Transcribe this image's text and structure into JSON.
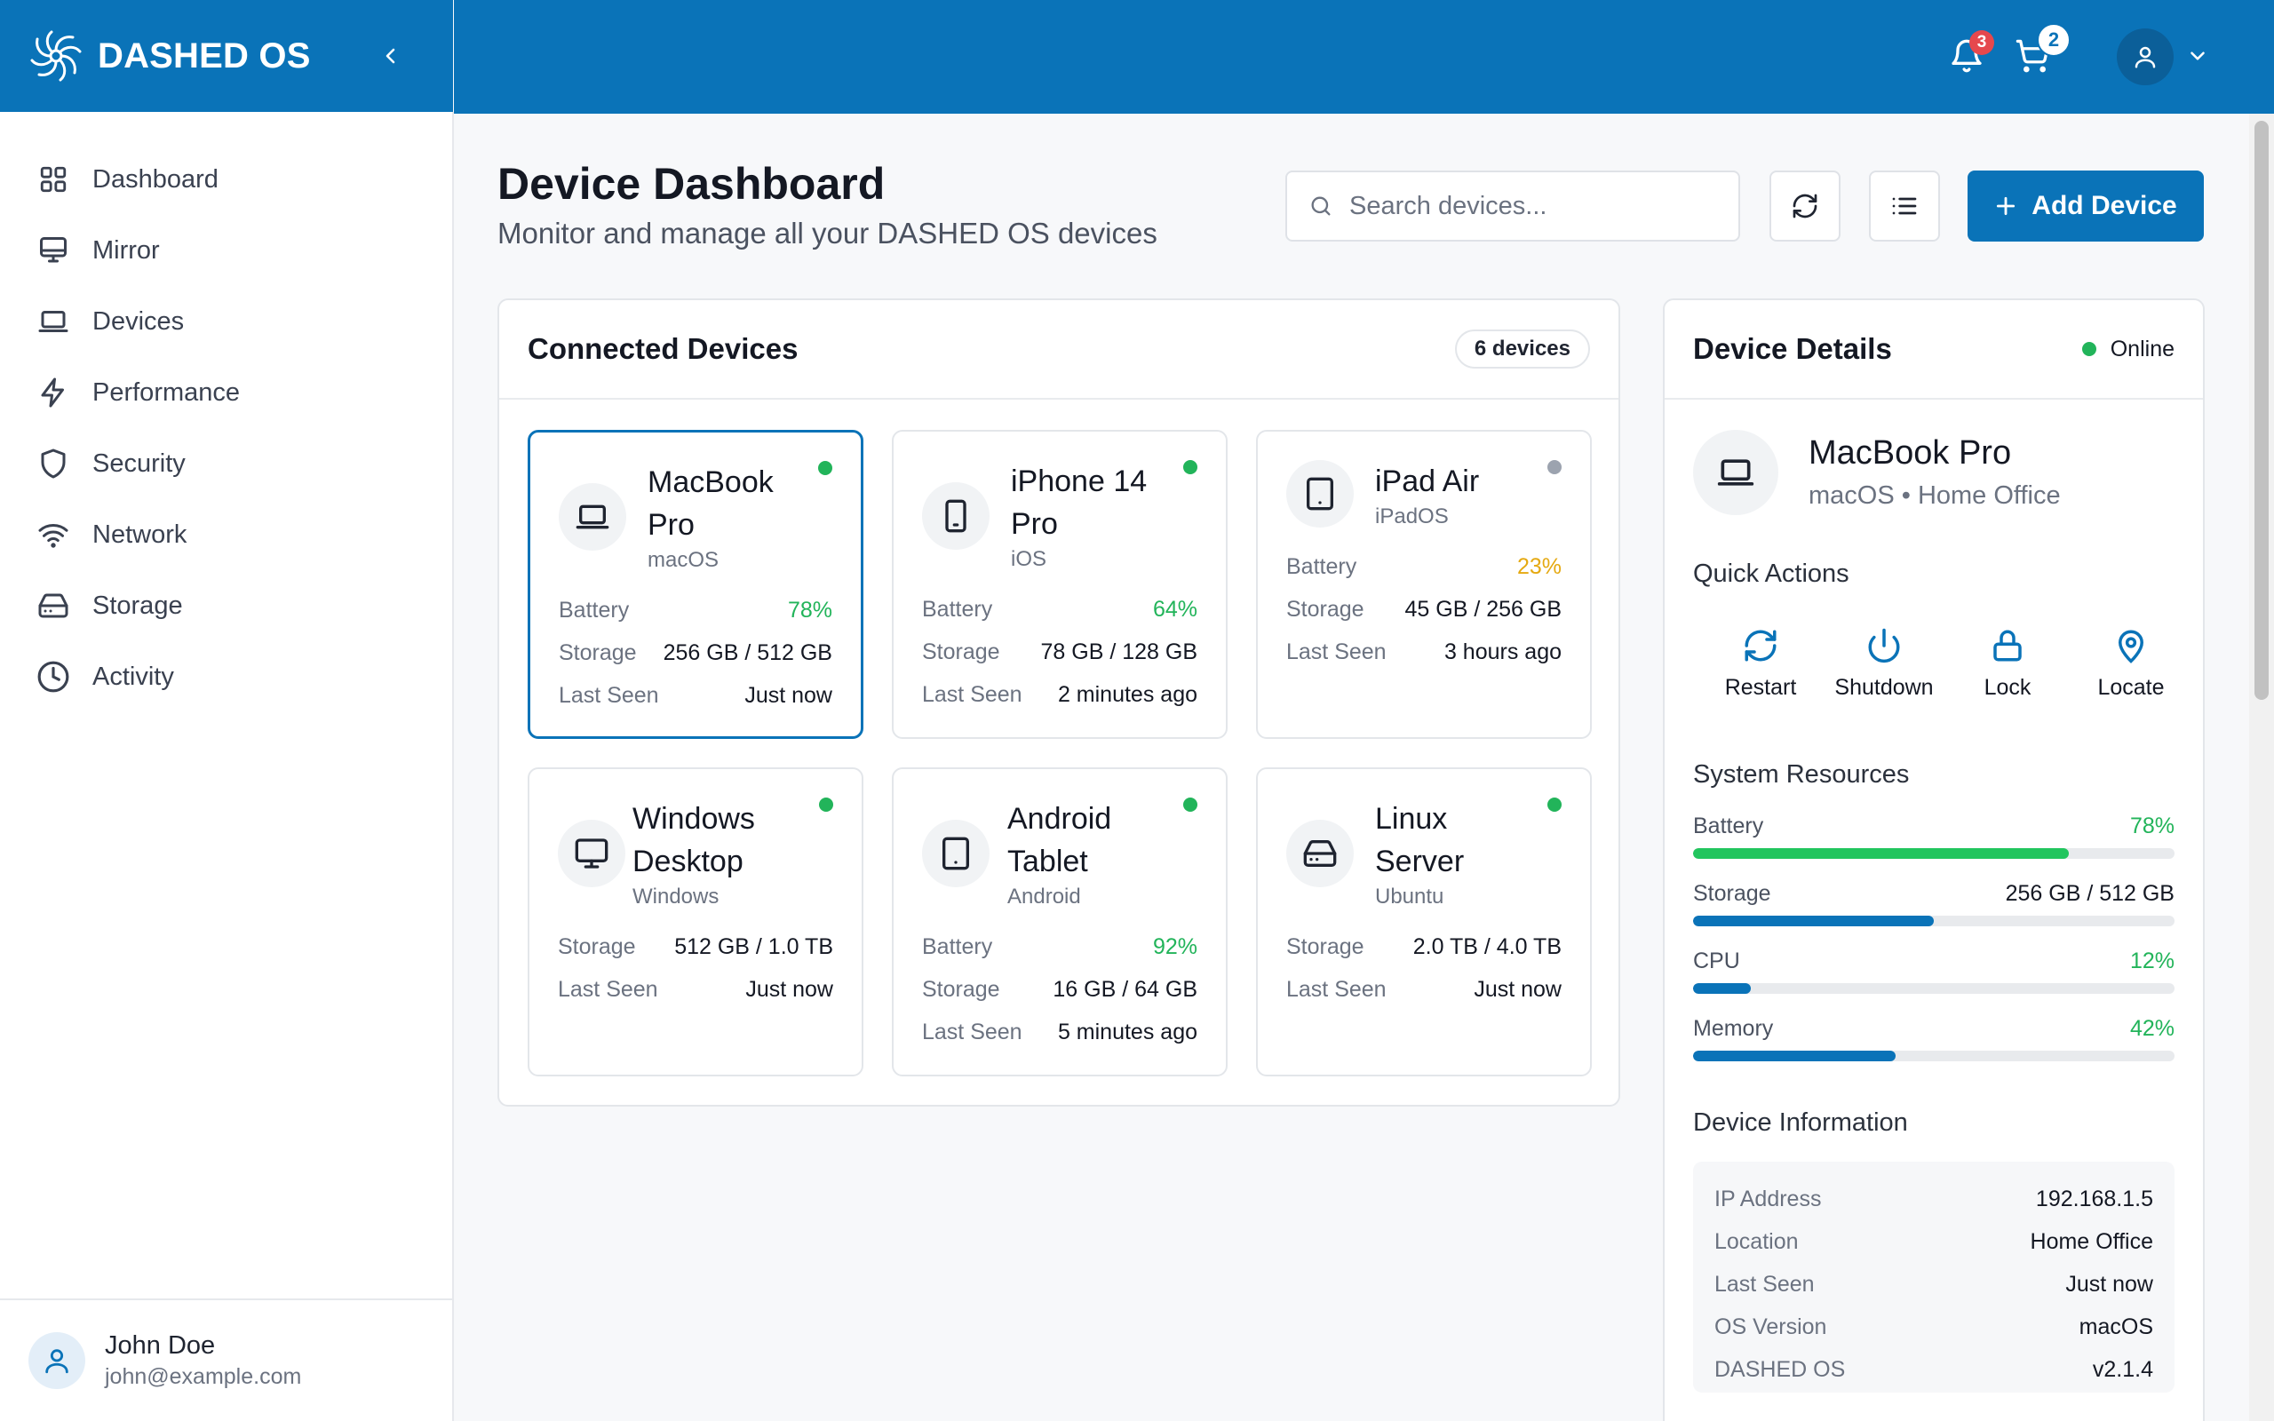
{
  "brand": {
    "name": "DASHED OS"
  },
  "topbar": {
    "notifications_count": "3",
    "cart_count": "2"
  },
  "sidebar": {
    "items": [
      {
        "label": "Dashboard",
        "icon": "grid-icon"
      },
      {
        "label": "Mirror",
        "icon": "monitor-icon"
      },
      {
        "label": "Devices",
        "icon": "laptop-icon"
      },
      {
        "label": "Performance",
        "icon": "bolt-icon"
      },
      {
        "label": "Security",
        "icon": "shield-icon"
      },
      {
        "label": "Network",
        "icon": "wifi-icon"
      },
      {
        "label": "Storage",
        "icon": "hard-drive-icon"
      },
      {
        "label": "Activity",
        "icon": "clock-icon"
      }
    ],
    "user": {
      "name": "John Doe",
      "email": "john@example.com"
    }
  },
  "header": {
    "title": "Device Dashboard",
    "subtitle": "Monitor and manage all your DASHED OS devices",
    "search_placeholder": "Search devices...",
    "add_label": "Add Device"
  },
  "devices_panel": {
    "title": "Connected Devices",
    "count_label": "6 devices",
    "devices": [
      {
        "name1": "MacBook",
        "name2": "Pro",
        "os": "macOS",
        "status": "online",
        "rows": [
          {
            "k": "Battery",
            "v": "78%",
            "tone": "green"
          },
          {
            "k": "Storage",
            "v": "256 GB / 512 GB"
          },
          {
            "k": "Last Seen",
            "v": "Just now"
          }
        ]
      },
      {
        "name1": "iPhone 14",
        "name2": "Pro",
        "os": "iOS",
        "status": "online",
        "rows": [
          {
            "k": "Battery",
            "v": "64%",
            "tone": "green"
          },
          {
            "k": "Storage",
            "v": "78 GB / 128 GB"
          },
          {
            "k": "Last Seen",
            "v": "2 minutes ago"
          }
        ]
      },
      {
        "name1": "iPad Air",
        "name2": "",
        "os": "iPadOS",
        "status": "offline",
        "rows": [
          {
            "k": "Battery",
            "v": "23%",
            "tone": "yellow"
          },
          {
            "k": "Storage",
            "v": "45 GB / 256 GB"
          },
          {
            "k": "Last Seen",
            "v": "3 hours ago"
          }
        ]
      },
      {
        "name1": "Windows",
        "name2": "Desktop",
        "os": "Windows",
        "status": "online",
        "rows": [
          {
            "k": "Storage",
            "v": "512 GB / 1.0 TB"
          },
          {
            "k": "Last Seen",
            "v": "Just now"
          }
        ]
      },
      {
        "name1": "Android",
        "name2": "Tablet",
        "os": "Android",
        "status": "online",
        "rows": [
          {
            "k": "Battery",
            "v": "92%",
            "tone": "green"
          },
          {
            "k": "Storage",
            "v": "16 GB / 64 GB"
          },
          {
            "k": "Last Seen",
            "v": "5 minutes ago"
          }
        ]
      },
      {
        "name1": "Linux",
        "name2": "Server",
        "os": "Ubuntu",
        "status": "online",
        "rows": [
          {
            "k": "Storage",
            "v": "2.0 TB / 4.0 TB"
          },
          {
            "k": "Last Seen",
            "v": "Just now"
          }
        ]
      }
    ]
  },
  "details": {
    "title": "Device Details",
    "status": "Online",
    "device_name": "MacBook Pro",
    "device_sub": "macOS • Home Office",
    "quick_actions_label": "Quick Actions",
    "quick_actions": [
      {
        "label": "Restart"
      },
      {
        "label": "Shutdown"
      },
      {
        "label": "Lock"
      },
      {
        "label": "Locate"
      }
    ],
    "resources_label": "System Resources",
    "resources": [
      {
        "k": "Battery",
        "v": "78%",
        "pct": 78,
        "color": "#22c55e",
        "tone": "green"
      },
      {
        "k": "Storage",
        "v": "256 GB / 512 GB",
        "pct": 50,
        "color": "#0a73b8",
        "tone": ""
      },
      {
        "k": "CPU",
        "v": "12%",
        "pct": 12,
        "color": "#0a73b8",
        "tone": "green"
      },
      {
        "k": "Memory",
        "v": "42%",
        "pct": 42,
        "color": "#0a73b8",
        "tone": "green"
      }
    ],
    "info_label": "Device Information",
    "info": [
      {
        "k": "IP Address",
        "v": "192.168.1.5"
      },
      {
        "k": "Location",
        "v": "Home Office"
      },
      {
        "k": "Last Seen",
        "v": "Just now"
      },
      {
        "k": "OS Version",
        "v": "macOS"
      },
      {
        "k": "DASHED OS",
        "v": "v2.1.4"
      }
    ]
  },
  "colors": {
    "brand": "#0a73b8",
    "online": "#22b45a",
    "offline": "#9ca3af",
    "warning": "#e5a911"
  }
}
